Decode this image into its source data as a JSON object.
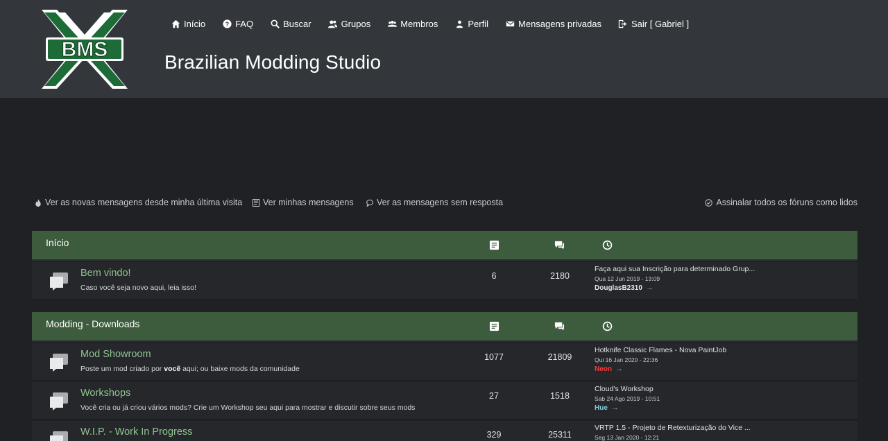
{
  "header": {
    "logo_text": "BMS",
    "site_title": "Brazilian Modding Studio",
    "nav": [
      {
        "label": "Início",
        "icon": "home-icon"
      },
      {
        "label": "FAQ",
        "icon": "question-icon"
      },
      {
        "label": "Buscar",
        "icon": "search-icon"
      },
      {
        "label": "Grupos",
        "icon": "groups-icon"
      },
      {
        "label": "Membros",
        "icon": "members-icon"
      },
      {
        "label": "Perfil",
        "icon": "user-icon"
      },
      {
        "label": "Mensagens privadas",
        "icon": "mail-icon"
      },
      {
        "label": "Sair [ Gabriel ]",
        "icon": "logout-icon"
      }
    ]
  },
  "quicklinks": {
    "new_posts": "Ver as novas mensagens desde minha última visita",
    "my_posts": "Ver minhas mensagens",
    "unanswered": "Ver as mensagens sem resposta",
    "mark_read": "Assinalar todos os fóruns como lidos"
  },
  "categories": [
    {
      "title": "Início",
      "forums": [
        {
          "title": "Bem vindo!",
          "description": "Caso você seja novo aqui, leia isso!",
          "topics": "6",
          "posts": "2180",
          "last_post": {
            "title": "Faça aqui sua Inscrição para determinado Grup...",
            "date": "Qua 12 Jun 2019 - 13:09",
            "user": "DouglasB2310"
          }
        }
      ]
    },
    {
      "title": "Modding - Downloads",
      "forums": [
        {
          "title": "Mod Showroom",
          "description_pre": "Poste um mod criado por ",
          "description_bold": "você",
          "description_post": " aqui; ou baixe mods da comunidade",
          "topics": "1077",
          "posts": "21809",
          "last_post": {
            "title": "Hotknife Classic Flames - Nova PaintJob",
            "date": "Qui 16 Jan 2020 - 22:36",
            "user": "Neon"
          }
        },
        {
          "title": "Workshops",
          "description": "Você cria ou já criou vários mods? Crie um Workshop seu aqui para mostrar e discutir sobre seus mods",
          "topics": "27",
          "posts": "1518",
          "last_post": {
            "title": "Cloud's Workshop",
            "date": "Sab 24 Ago 2019 - 10:51",
            "user": "Hue"
          }
        },
        {
          "title": "W.I.P. - Work In Progress",
          "topics": "329",
          "posts": "25311",
          "last_post": {
            "title": "VRTP 1.5 - Projeto de Retexturização do Vice ...",
            "date": "Seg 13 Jan 2020 - 12:21"
          }
        }
      ]
    }
  ],
  "colors": {
    "header_bg": "#33373b",
    "page_bg": "#1f2124",
    "category_bg": "#3d5b3d",
    "row_bg": "#25272a",
    "forum_link": "#8fc48f",
    "user_red": "#ff3b3b",
    "user_teal": "#7fd0e0"
  }
}
